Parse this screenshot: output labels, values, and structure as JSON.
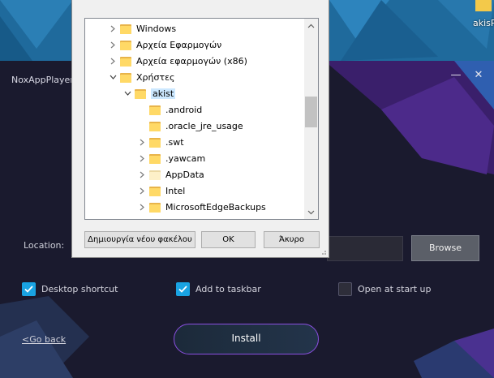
{
  "desktop": {
    "icon_label": "akisP"
  },
  "installer": {
    "title": "NoxAppPlayer",
    "minimize_glyph": "—",
    "close_glyph": "✕",
    "location_label": "Location:",
    "browse_label": "Browse",
    "options": [
      {
        "label": "Desktop shortcut",
        "checked": true
      },
      {
        "label": "Add to taskbar",
        "checked": true
      },
      {
        "label": "Open at start up",
        "checked": false
      }
    ],
    "go_back_label": "<Go back",
    "install_label": "Install",
    "colors": {
      "accent": "#19a3e3",
      "install_border": "#8a4fe0",
      "background": "#1a1a2e"
    }
  },
  "dialog": {
    "tree": [
      {
        "label": "Windows",
        "expander": "collapsed",
        "level": 0
      },
      {
        "label": "Αρχεία Εφαρμογών",
        "expander": "collapsed",
        "level": 0
      },
      {
        "label": "Αρχεία εφαρμογών (x86)",
        "expander": "collapsed",
        "level": 0
      },
      {
        "label": "Χρήστες",
        "expander": "expanded",
        "level": 0
      },
      {
        "label": "akist",
        "expander": "expanded",
        "level": 1,
        "selected": true
      },
      {
        "label": ".android",
        "expander": "none",
        "level": 2
      },
      {
        "label": ".oracle_jre_usage",
        "expander": "none",
        "level": 2
      },
      {
        "label": ".swt",
        "expander": "collapsed",
        "level": 2
      },
      {
        "label": ".yawcam",
        "expander": "collapsed",
        "level": 2
      },
      {
        "label": "AppData",
        "expander": "collapsed",
        "level": 2,
        "pale": true
      },
      {
        "label": "Intel",
        "expander": "collapsed",
        "level": 2
      },
      {
        "label": "MicrosoftEdgeBackups",
        "expander": "collapsed",
        "level": 2
      }
    ],
    "new_folder_label": "Δημιουργία νέου φακέλου",
    "ok_label": "OK",
    "cancel_label": "Άκυρο"
  }
}
